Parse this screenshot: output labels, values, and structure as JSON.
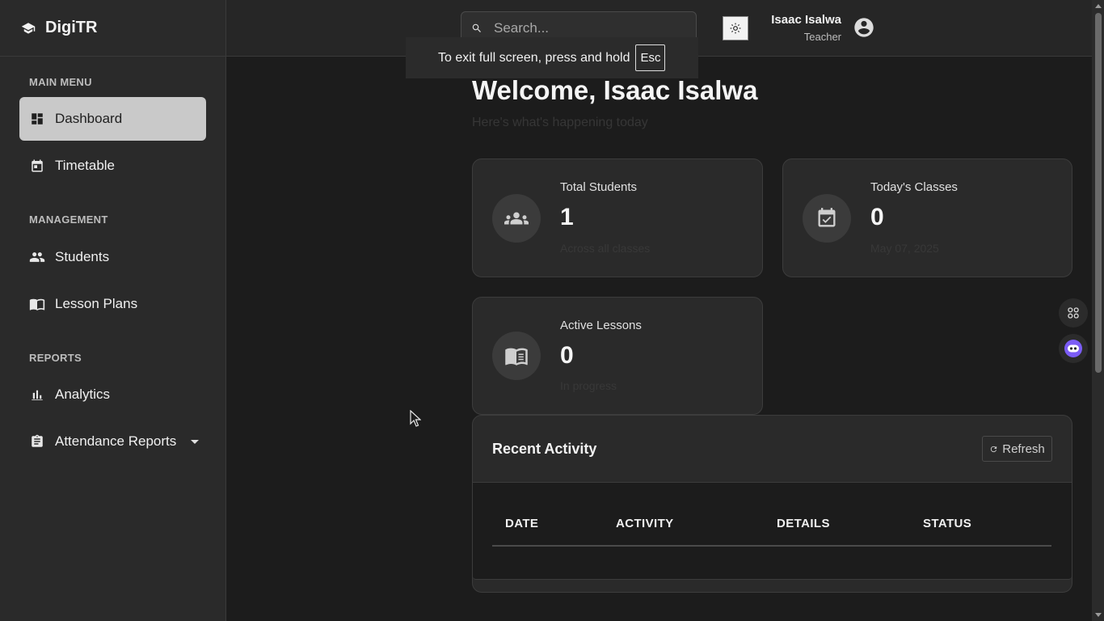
{
  "brand": {
    "name": "DigiTR",
    "icon": "graduation-cap-icon"
  },
  "sidebar": {
    "sections": [
      {
        "label": "MAIN MENU",
        "items": [
          {
            "label": "Dashboard",
            "icon": "dashboard-icon",
            "active": true
          },
          {
            "label": "Timetable",
            "icon": "calendar-icon"
          }
        ]
      },
      {
        "label": "MANAGEMENT",
        "items": [
          {
            "label": "Students",
            "icon": "people-icon"
          },
          {
            "label": "Lesson Plans",
            "icon": "book-icon"
          }
        ]
      },
      {
        "label": "REPORTS",
        "items": [
          {
            "label": "Analytics",
            "icon": "bar-chart-icon"
          },
          {
            "label": "Attendance Reports",
            "icon": "clipboard-icon",
            "has_dropdown": true
          }
        ]
      }
    ]
  },
  "header": {
    "search_placeholder": "Search...",
    "user_name": "Isaac Isalwa",
    "user_role": "Teacher"
  },
  "toast": {
    "text": "To exit full screen, press and hold",
    "key": "Esc"
  },
  "main": {
    "welcome": "Welcome, Isaac Isalwa",
    "subtitle": "Here's what's happening today",
    "cards": [
      {
        "title": "Total Students",
        "value": "1",
        "sub": "Across all classes",
        "icon": "people-icon"
      },
      {
        "title": "Today's Classes",
        "value": "0",
        "sub": "May 07, 2025",
        "icon": "calendar-check-icon"
      },
      {
        "title": "Active Lessons",
        "value": "0",
        "sub": "In progress",
        "icon": "book-icon"
      }
    ],
    "activity": {
      "title": "Recent Activity",
      "refresh_label": "Refresh",
      "columns": [
        "DATE",
        "ACTIVITY",
        "DETAILS",
        "STATUS"
      ]
    }
  },
  "colors": {
    "accent_active_bg": "#c9c9c9",
    "background": "#1c1c1c",
    "card_bg": "#2a2a2a"
  }
}
